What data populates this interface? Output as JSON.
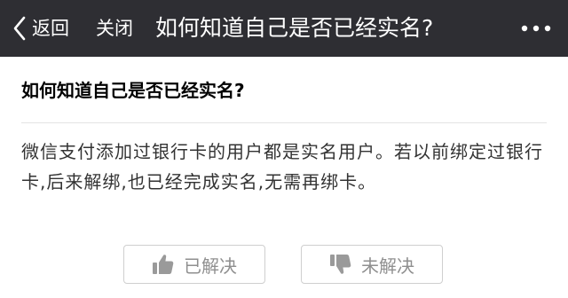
{
  "topbar": {
    "back_label": "返回",
    "close_label": "关闭",
    "title": "如何知道自己是否已经实名?",
    "icons": {
      "back": "chevron-left-icon",
      "more": "more-dots-icon"
    }
  },
  "card": {
    "question": "如何知道自己是否已经实名?",
    "answer": "微信支付添加过银行卡的用户都是实名用户。若以前绑定过银行卡,后来解绑,也已经完成实名,无需再绑卡。"
  },
  "feedback": {
    "solved_label": "已解决",
    "unsolved_label": "未解决",
    "icons": {
      "solved": "thumbs-up-icon",
      "unsolved": "thumbs-down-icon"
    }
  },
  "colors": {
    "topbar_bg": "#2e2e33",
    "button_text": "#8f8f8f",
    "button_border": "#cfcfcf"
  }
}
